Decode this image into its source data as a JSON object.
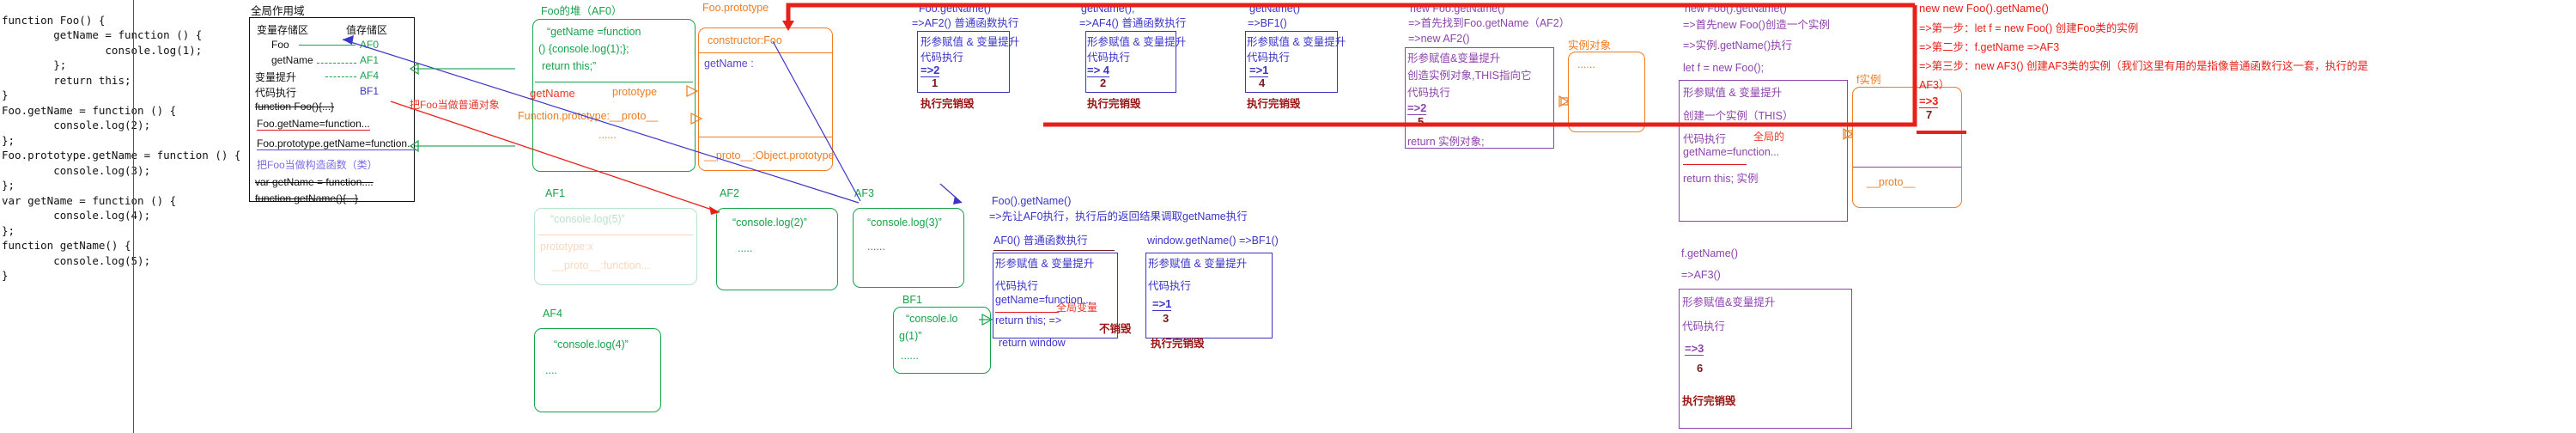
{
  "code_listing": "function Foo() {\n        getName = function () {\n                console.log(1);\n        };\n        return this;\n}\nFoo.getName = function () {\n        console.log(2);\n};\nFoo.prototype.getName = function () {\n        console.log(3);\n};\nvar getName = function () {\n        console.log(4);\n};\nfunction getName() {\n        console.log(5);\n}",
  "global_scope": {
    "title": "全局作用域",
    "col_left": "变量存储区",
    "col_right": "值存储区",
    "vars": [
      {
        "name": "Foo",
        "value": "AF0"
      },
      {
        "name": "getName",
        "value": "AF1"
      },
      {
        "name": "",
        "value": "AF4"
      },
      {
        "name": "",
        "value": "BF1"
      }
    ],
    "hoist_label": "变量提升",
    "exec_label": "代码执行",
    "lines": [
      "function Foo(){...}",
      "Foo.getName=function...",
      "Foo.prototype.getName=function...",
      "var getName = function....",
      "function getName(){...}"
    ],
    "note_red": "把Foo当做普通对象",
    "note_purple": "把Foo当做构造函数（类）"
  },
  "heap_foo": {
    "title": "Foo的堆（AF0）",
    "body1": "“getName =function",
    "body2": "() {console.log(1);};",
    "body3": "return this;”",
    "key_getname": "getName",
    "key_prototype": "prototype",
    "proto_line": "Function.prototype:__proto__",
    "dots": "......"
  },
  "foo_prototype": {
    "title": "Foo.prototype",
    "constructor": "constructor:Foo",
    "getname": "getName :",
    "proto": "__proto__:Object.prototype"
  },
  "heaps": [
    {
      "id": "af1",
      "title": "AF1",
      "l1": "“console.log(5)”",
      "l2": "prototype:x",
      "l3": "__proto__:function...",
      "faded": true
    },
    {
      "id": "af2",
      "title": "AF2",
      "l1": "“console.log(2)”",
      "l2": "....."
    },
    {
      "id": "af3",
      "title": "AF3",
      "l1": "“console.log(3)”",
      "l2": "......"
    },
    {
      "id": "af4",
      "title": "AF4",
      "l1": "“console.log(4)”",
      "l2": "...."
    },
    {
      "id": "bf1",
      "title": "BF1",
      "l1": "“console.lo",
      "l1b": "g(1)”",
      "l2": "......"
    }
  ],
  "contexts": [
    {
      "id": "foo-getname",
      "head1": "Foo.getName()",
      "head2": "=>AF2() 普通函数执行",
      "rows": [
        "形参赋值 & 变量提升",
        "代码执行"
      ],
      "result": "=>2",
      "order": "1",
      "destroy": "执行完销毁"
    },
    {
      "id": "getname-call",
      "head1": "getName();",
      "head2": "=>AF4() 普通函数执行",
      "rows": [
        "形参赋值 & 变量提升",
        "代码执行"
      ],
      "result": "=> 4",
      "order": "2",
      "destroy": "执行完销毁"
    },
    {
      "id": "getname-bf1",
      "head1": "getName()",
      "head2": "=>BF1()",
      "rows": [
        "形参赋值 & 变量提升",
        "代码执行"
      ],
      "result": "=>1",
      "order": "4",
      "destroy": "执行完销毁"
    }
  ],
  "foo_call": {
    "head1": "Foo().getName()",
    "head2": "=>先让AF0执行，执行后的返回结果调取getName执行",
    "head3": "AF0() 普通函数执行",
    "rows": [
      "形参赋值 & 变量提升",
      "代码执行"
    ],
    "assign": "getName=function...",
    "note_global": "全局变量",
    "ret1": "return this; =>",
    "ret2": "return window",
    "nodestroy": "不销毁"
  },
  "window_getname": {
    "head": "window.getName()  =>BF1()",
    "rows": [
      "形参赋值 & 变量提升",
      "代码执行"
    ],
    "result": "=>1",
    "order": "3",
    "destroy": "执行完销毁"
  },
  "new_foo_getname": {
    "head1": "new Foo.getName()",
    "head2": "=>首先找到Foo.getName（AF2）",
    "head3": "=>new AF2()",
    "rows": [
      "形参赋值&变量提升",
      "创造实例对象,THIS指向它",
      "代码执行"
    ],
    "result": "=>2",
    "order": "5",
    "ret": "return 实例对象;",
    "instance_title": "实例对象",
    "instance_dots": "......"
  },
  "new_foo_dot_getname": {
    "head1": "new Foo().getName()",
    "head2": "=>首先new Foo()创造一个实例",
    "head3": "=>实例.getName()执行",
    "head4": "let f = new Foo();",
    "rows": [
      "形参赋值 & 变量提升",
      "创建一个实例（THIS）",
      "代码执行"
    ],
    "note_global": "全局的",
    "assign": "getName=function...",
    "ret": "return this; 实例",
    "instance_title": "f实例",
    "instance_proto": "__proto__",
    "sub_head1": "f.getName()",
    "sub_head2": "=>AF3()",
    "sub_rows": [
      "形参赋值&变量提升",
      "代码执行"
    ],
    "sub_result": "=>3",
    "sub_order": "6",
    "sub_destroy": "执行完销毁"
  },
  "new_new": {
    "head1": "new new Foo().getName()",
    "step1": "=>第一步：let f = new Foo()   创建Foo类的实例",
    "step2": "=>第二步：f.getName  =>AF3",
    "step3": "=>第三步：new AF3()   创建AF3类的实例（我们这里有用的是指像普通函数行这一套，执行的是AF3）",
    "result": "=>3",
    "order": "7"
  }
}
